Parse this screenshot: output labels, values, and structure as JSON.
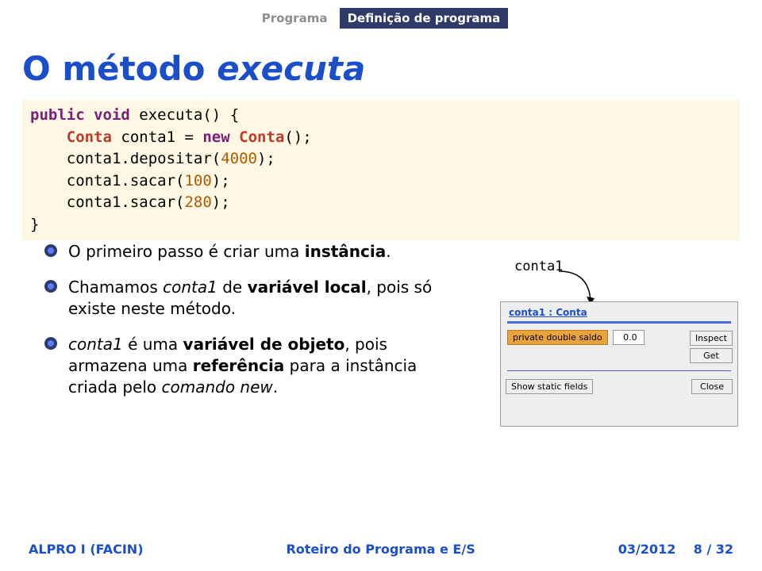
{
  "nav": {
    "tab1": "Programa",
    "tab2": "Definição de programa"
  },
  "title": {
    "prefix": "O método ",
    "em": "executa"
  },
  "code": {
    "l1a": "public",
    "l1b": " ",
    "l1c": "void",
    "l1d": " executa() {",
    "l2a": "    ",
    "l2b": "Conta",
    "l2c": " conta1 = ",
    "l2d": "new",
    "l2e": " ",
    "l2f": "Conta",
    "l2g": "();",
    "l3a": "    conta1.depositar(",
    "l3b": "4000",
    "l3c": ");",
    "l4a": "    conta1.sacar(",
    "l4b": "100",
    "l4c": ");",
    "l5a": "    conta1.sacar(",
    "l5b": "280",
    "l5c": ");",
    "l6": "}"
  },
  "bullets": {
    "b1": {
      "t1": "O primeiro passo é criar uma ",
      "t2": "instância",
      "t3": "."
    },
    "b2": {
      "t1": "Chamamos ",
      "t2": "conta1",
      "t3": " de ",
      "t4": "variável local",
      "t5": ", pois só existe neste método."
    },
    "b3": {
      "t1": "conta1",
      "t2": " é uma ",
      "t3": "variável de objeto",
      "t4": ", pois armazena uma ",
      "t5": "referência",
      "t6": " para a instância criada pelo ",
      "t7": "comando new",
      "t8": "."
    }
  },
  "diagram": {
    "label": "conta1",
    "insp_title": "conta1 : Conta",
    "field_name": "private double saldo",
    "field_value": "0.0",
    "btn_inspect": "Inspect",
    "btn_get": "Get",
    "btn_show_static": "Show static fields",
    "btn_close": "Close"
  },
  "footer": {
    "left": "ALPRO I (FACIN)",
    "center": "Roteiro do Programa e E/S",
    "date": "03/2012",
    "page": "8 / 32"
  }
}
